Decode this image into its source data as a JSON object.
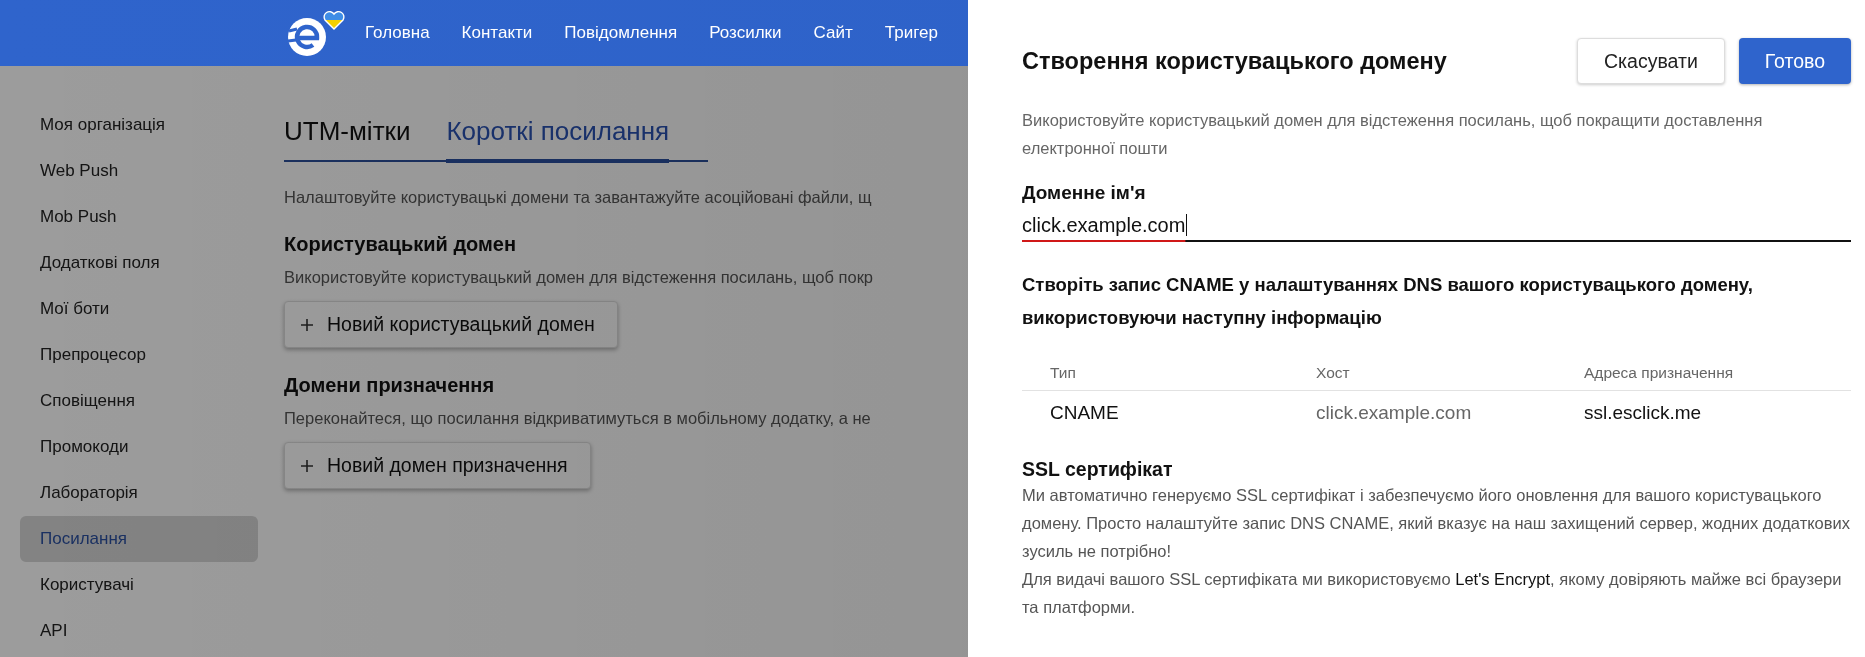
{
  "header": {
    "nav": [
      "Головна",
      "Контакти",
      "Повідомлення",
      "Розсилки",
      "Сайт",
      "Тригер"
    ]
  },
  "sidebar": {
    "items": [
      {
        "label": "Моя організація",
        "selected": false
      },
      {
        "label": "Web Push",
        "selected": false
      },
      {
        "label": "Mob Push",
        "selected": false
      },
      {
        "label": "Додаткові поля",
        "selected": false
      },
      {
        "label": "Мої боти",
        "selected": false
      },
      {
        "label": "Препроцесор",
        "selected": false
      },
      {
        "label": "Сповіщення",
        "selected": false
      },
      {
        "label": "Промокоди",
        "selected": false
      },
      {
        "label": "Лабораторія",
        "selected": false
      },
      {
        "label": "Посилання",
        "selected": true
      },
      {
        "label": "Користувачі",
        "selected": false
      },
      {
        "label": "API",
        "selected": false
      }
    ]
  },
  "tabs": [
    {
      "label": "UTM-мітки",
      "selected": false
    },
    {
      "label": "Короткі посилання",
      "selected": true
    }
  ],
  "intro": "Налаштовуйте користувацькі домени та завантажуйте асоційовані файли, щ",
  "sections": [
    {
      "title": "Користувацький домен",
      "description": "Використовуйте користувацький домен для відстеження посилань, щоб покр",
      "button": "Новий користувацький домен"
    },
    {
      "title": "Домени призначення",
      "description": "Переконайтеся, що посилання відкриватимуться в мобільному додатку, а не",
      "button": "Новий домен призначення"
    }
  ],
  "panel": {
    "title": "Створення користувацького домену",
    "buttons": [
      {
        "label": "Скасувати",
        "kind": "secondary"
      },
      {
        "label": "Готово",
        "kind": "primary"
      }
    ],
    "description": "Використовуйте користувацький домен для відстеження посилань, щоб покращити доставлення електронної пошти",
    "field": {
      "label": "Доменне ім'я",
      "value": "click.example.com"
    },
    "instruction": "Створіть запис CNAME у налаштуваннях DNS вашого користувацького домену, використовуючи наступну інформацію",
    "table": {
      "columns": [
        "Тип",
        "Хост",
        "Адреса призначення"
      ],
      "rows": [
        [
          "CNAME",
          "click.example.com",
          "ssl.esclick.me"
        ]
      ]
    },
    "ssl": {
      "title": "SSL сертифікат",
      "paragraphs": [
        {
          "text": "Ми автоматично генеруємо SSL сертифікат і забезпечуємо його оновлення для вашого користувацького домену. Просто налаштуйте запис DNS CNAME, який вказує на наш захищений сервер, жодних додаткових зусиль не потрібно!"
        },
        {
          "text": "Для видачі вашого SSL сертифіката ми використовуємо ",
          "link": "Let's Encrypt",
          "after": ", якому довіряють майже всі браузери та платформи."
        }
      ]
    }
  }
}
